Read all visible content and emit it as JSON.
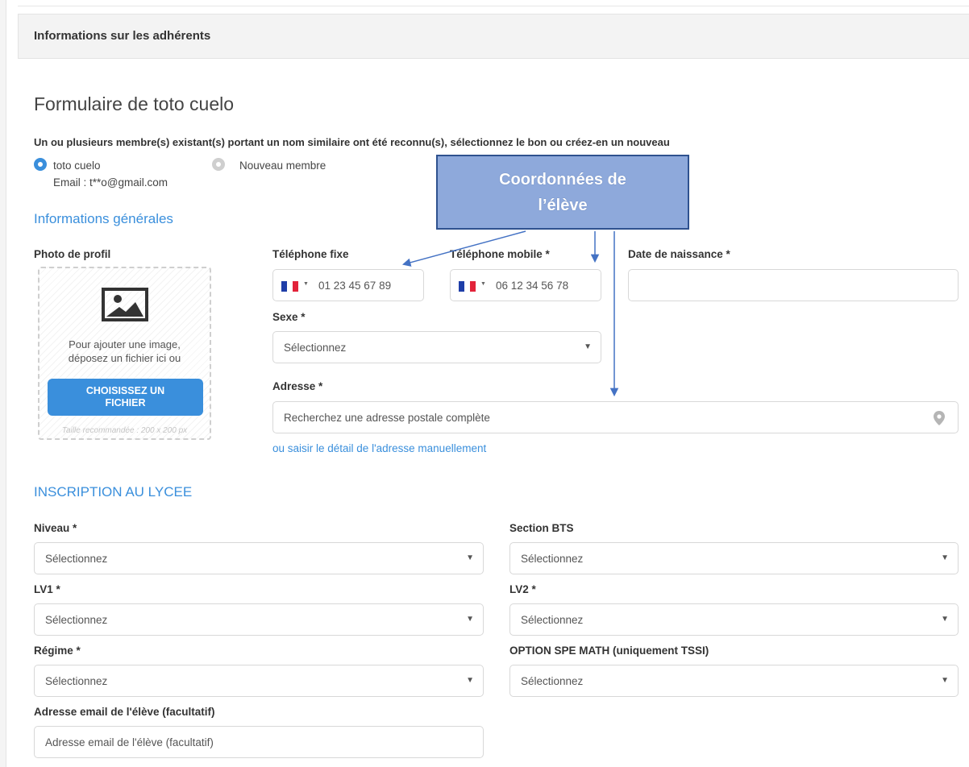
{
  "section_title": "Informations sur les adhérents",
  "form_title": "Formulaire de toto cuelo",
  "duplicate_notice": "Un ou plusieurs membre(s) existant(s) portant un nom similaire ont été reconnu(s), sélectionnez le bon ou créez-en un nouveau",
  "member_choice": {
    "existing_label": "toto cuelo",
    "existing_email": "Email : t**o@gmail.com",
    "new_label": "Nouveau membre",
    "selected": "existing"
  },
  "general_info": {
    "heading": "Informations générales",
    "photo": {
      "label": "Photo de profil",
      "drop_text_1": "Pour ajouter une image,",
      "drop_text_2": "déposez un fichier ici ou",
      "button_line_1": "CHOISISSEZ UN",
      "button_line_2": "FICHIER",
      "size_note": "Taille recommandée : 200 x 200 px"
    },
    "phone_fixed": {
      "label": "Téléphone fixe",
      "value": "01 23 45 67 89",
      "flag": "FR"
    },
    "phone_mobile": {
      "label": "Téléphone mobile *",
      "value": "06 12 34 56 78",
      "flag": "FR"
    },
    "birth_date": {
      "label": "Date de naissance *",
      "value": ""
    },
    "sex": {
      "label": "Sexe *",
      "value": "Sélectionnez"
    },
    "address": {
      "label": "Adresse *",
      "placeholder": "Recherchez une adresse postale complète",
      "manual_link": "ou saisir le détail de l'adresse manuellement"
    }
  },
  "school": {
    "heading": "INSCRIPTION AU LYCEE",
    "niveau": {
      "label": "Niveau *",
      "value": "Sélectionnez"
    },
    "section_bts": {
      "label": "Section BTS",
      "value": "Sélectionnez"
    },
    "lv1": {
      "label": "LV1 *",
      "value": "Sélectionnez"
    },
    "lv2": {
      "label": "LV2 *",
      "value": "Sélectionnez"
    },
    "regime": {
      "label": "Régime *",
      "value": "Sélectionnez"
    },
    "option_math": {
      "label": "OPTION SPE MATH (uniquement TSSI)",
      "value": "Sélectionnez"
    },
    "email": {
      "label": "Adresse email de l'élève (facultatif)",
      "placeholder": "Adresse email de l'élève (facultatif)"
    }
  },
  "callout": {
    "line_1": "Coordonnées de",
    "line_2": "l’élève"
  },
  "colors": {
    "accent": "#3a8fdc",
    "callout_fill": "#8ea9db",
    "callout_border": "#2f528f",
    "arrow": "#4472c4"
  },
  "icons": [
    "image-icon",
    "map-pin-icon",
    "caret-down-icon",
    "flag-fr-icon",
    "radio-icon"
  ]
}
